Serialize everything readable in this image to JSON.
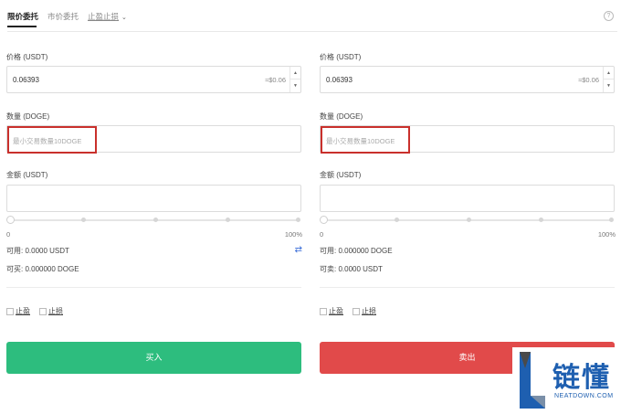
{
  "tabs": {
    "limit": "限价委托",
    "market": "市价委托",
    "stop": "止盈止损",
    "stop_chevron": "chevron-down-icon"
  },
  "help_icon": "?",
  "buy": {
    "price_label": "价格 (USDT)",
    "price_value": "0.06393",
    "price_approx": "≈$0.06",
    "qty_label": "数量 (DOGE)",
    "qty_placeholder": "最小交易数量10DOGE",
    "amount_label": "金额 (USDT)",
    "amount_value": "",
    "pct_min": "0",
    "pct_max": "100%",
    "slider_percent": 0,
    "available": "可用: 0.0000 USDT",
    "can_trade": "可买: 0.000000 DOGE",
    "take_profit": "止盈",
    "stop_loss": "止损",
    "button": "买入",
    "button_color": "#2dbd7e"
  },
  "sell": {
    "price_label": "价格 (USDT)",
    "price_value": "0.06393",
    "price_approx": "≈$0.06",
    "qty_label": "数量 (DOGE)",
    "qty_placeholder": "最小交易数量10DOGE",
    "amount_label": "金额 (USDT)",
    "amount_value": "",
    "pct_min": "0",
    "pct_max": "100%",
    "slider_percent": 0,
    "available": "可用: 0.000000 DOGE",
    "can_trade": "可卖: 0.0000 USDT",
    "take_profit": "止盈",
    "stop_loss": "止损",
    "button": "卖出",
    "button_color": "#e14a4a"
  },
  "watermark": {
    "brand": "链懂",
    "site": "NEATDOWN.COM"
  }
}
